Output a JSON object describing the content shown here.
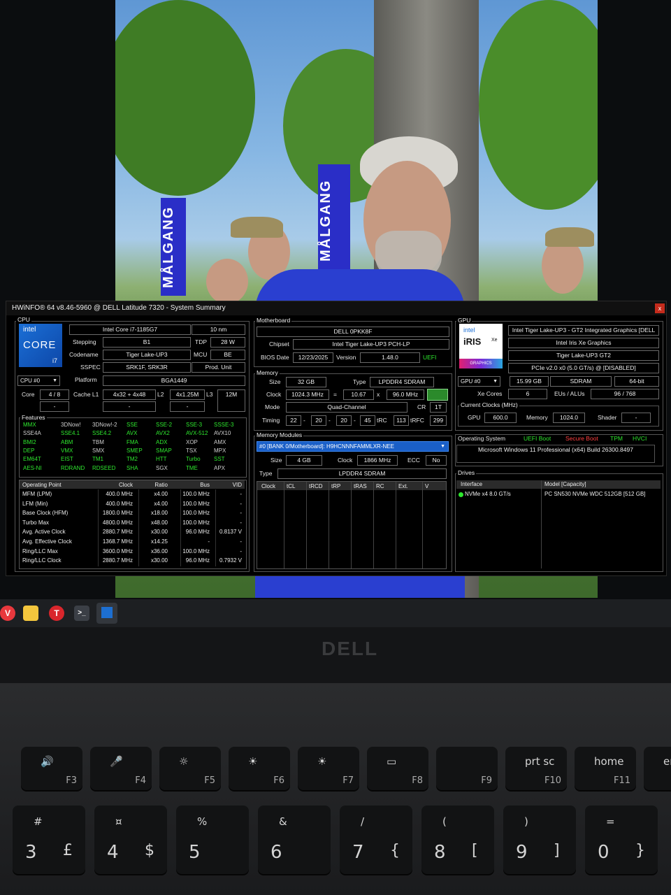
{
  "photo": {
    "banners": [
      "MÅLGANG",
      "MÅLGANG"
    ]
  },
  "window": {
    "title": "HWiNFO® 64 v8.46-5960 @ DELL Latitude 7320 - System Summary",
    "close": "x"
  },
  "cpu": {
    "group_label": "CPU",
    "logo_brand": "intel",
    "logo_core": "CORE",
    "logo_tier": "i7",
    "name": "Intel Core i7-1185G7",
    "process": "10 nm",
    "stepping_label": "Stepping",
    "stepping": "B1",
    "tdp_label": "TDP",
    "tdp": "28 W",
    "codename_label": "Codename",
    "codename": "Tiger Lake-UP3",
    "mcu_label": "MCU",
    "mcu": "BE",
    "sspec_label": "SSPEC",
    "sspec": "SRK1F, SRK3R",
    "prod_unit": "Prod. Unit",
    "selector": "CPU #0",
    "platform_label": "Platform",
    "platform": "BGA1449",
    "core_label": "Core",
    "core": "4 / 8",
    "cache_l1_label": "Cache L1",
    "cache_l1": "4x32 + 4x48",
    "l2_label": "L2",
    "l2": "4x1.25M",
    "l3_label": "L3",
    "l3": "12M",
    "blank1": "-",
    "blank2": "-",
    "blank3": "-",
    "features_label": "Features",
    "features": [
      [
        "MMX",
        "g"
      ],
      [
        "3DNow!",
        "w"
      ],
      [
        "3DNow!-2",
        "w"
      ],
      [
        "SSE",
        "g"
      ],
      [
        "SSE-2",
        "g"
      ],
      [
        "SSE-3",
        "g"
      ],
      [
        "SSSE-3",
        "g"
      ],
      [
        "SSE4A",
        "w"
      ],
      [
        "SSE4.1",
        "g"
      ],
      [
        "SSE4.2",
        "g"
      ],
      [
        "AVX",
        "g"
      ],
      [
        "AVX2",
        "g"
      ],
      [
        "AVX-512",
        "g"
      ],
      [
        "AVX10",
        "w"
      ],
      [
        "BMI2",
        "g"
      ],
      [
        "ABM",
        "g"
      ],
      [
        "TBM",
        "w"
      ],
      [
        "FMA",
        "g"
      ],
      [
        "ADX",
        "g"
      ],
      [
        "XOP",
        "w"
      ],
      [
        "AMX",
        "w"
      ],
      [
        "DEP",
        "g"
      ],
      [
        "VMX",
        "g"
      ],
      [
        "SMX",
        "w"
      ],
      [
        "SMEP",
        "g"
      ],
      [
        "SMAP",
        "g"
      ],
      [
        "TSX",
        "w"
      ],
      [
        "MPX",
        "w"
      ],
      [
        "EM64T",
        "g"
      ],
      [
        "EIST",
        "g"
      ],
      [
        "TM1",
        "g"
      ],
      [
        "TM2",
        "g"
      ],
      [
        "HTT",
        "g"
      ],
      [
        "Turbo",
        "g"
      ],
      [
        "SST",
        "g"
      ],
      [
        "AES-NI",
        "g"
      ],
      [
        "RDRAND",
        "g"
      ],
      [
        "RDSEED",
        "g"
      ],
      [
        "SHA",
        "g"
      ],
      [
        "SGX",
        "w"
      ],
      [
        "TME",
        "g"
      ],
      [
        "APX",
        "w"
      ]
    ],
    "op_headers": [
      "Operating Point",
      "Clock",
      "Ratio",
      "Bus",
      "VID"
    ],
    "op_rows": [
      [
        "MFM (LPM)",
        "400.0 MHz",
        "x4.00",
        "100.0 MHz",
        "-"
      ],
      [
        "LFM (Min)",
        "400.0 MHz",
        "x4.00",
        "100.0 MHz",
        "-"
      ],
      [
        "Base Clock (HFM)",
        "1800.0 MHz",
        "x18.00",
        "100.0 MHz",
        "-"
      ],
      [
        "Turbo Max",
        "4800.0 MHz",
        "x48.00",
        "100.0 MHz",
        "-"
      ],
      [
        "Avg. Active Clock",
        "2880.7 MHz",
        "x30.00",
        "96.0 MHz",
        "0.8137 V"
      ],
      [
        "Avg. Effective Clock",
        "1368.7 MHz",
        "x14.25",
        "-",
        "-"
      ],
      [
        "Ring/LLC Max",
        "3600.0 MHz",
        "x36.00",
        "100.0 MHz",
        "-"
      ],
      [
        "Ring/LLC Clock",
        "2880.7 MHz",
        "x30.00",
        "96.0 MHz",
        "0.7932 V"
      ]
    ]
  },
  "motherboard": {
    "group_label": "Motherboard",
    "name": "DELL 0PKK8F",
    "chipset_label": "Chipset",
    "chipset": "Intel Tiger Lake-UP3 PCH-LP",
    "bios_date_label": "BIOS Date",
    "bios_date": "12/23/2025",
    "version_label": "Version",
    "version": "1.48.0",
    "uefi": "UEFI"
  },
  "memory": {
    "group_label": "Memory",
    "size_label": "Size",
    "size": "32 GB",
    "type_label": "Type",
    "type": "LPDDR4 SDRAM",
    "clock_label": "Clock",
    "clock": "1024.3 MHz",
    "eq": "=",
    "ratio": "10.67",
    "x": "x",
    "bus": "96.0 MHz",
    "mode_label": "Mode",
    "mode": "Quad-Channel",
    "cr_label": "CR",
    "cr": "1T",
    "timing_label": "Timing",
    "t1": "22",
    "t2": "20",
    "t3": "20",
    "t4": "45",
    "dash": "-",
    "trc_label": "tRC",
    "trc": "113",
    "trfc_label": "tRFC",
    "trfc": "299"
  },
  "modules": {
    "group_label": "Memory Modules",
    "selected": "#0 [BANK 0/Motherboard]: H9HCNNNFAMMLXR-NEE",
    "size_label": "Size",
    "size": "4 GB",
    "clock_label": "Clock",
    "clock": "1866 MHz",
    "ecc_label": "ECC",
    "ecc": "No",
    "type_label": "Type",
    "type": "LPDDR4 SDRAM",
    "timing_headers": [
      "Clock",
      "tCL",
      "tRCD",
      "tRP",
      "tRAS",
      "RC",
      "Ext.",
      "V"
    ]
  },
  "gpu": {
    "group_label": "GPU",
    "logo_brand": "intel",
    "logo_name": "iRIS",
    "logo_sub": "Xe",
    "logo_graphics": "GRAPHICS",
    "name": "Intel Tiger Lake-UP3 - GT2 Integrated Graphics [DELL",
    "subname": "Intel Iris Xe Graphics",
    "codename": "Tiger Lake-UP3 GT2",
    "pcie": "PCIe v2.0 x0 (5.0 GT/s) @ [DISABLED]",
    "selector": "GPU #0",
    "vram": "15.99 GB",
    "vram_type": "SDRAM",
    "bus_width": "64-bit",
    "xe_cores_label": "Xe Cores",
    "xe_cores": "6",
    "eus_label": "EUs / ALUs",
    "eus": "96 / 768",
    "clocks_label": "Current Clocks (MHz)",
    "gpu_clock_label": "GPU",
    "gpu_clock": "600.0",
    "mem_clock_label": "Memory",
    "mem_clock": "1024.0",
    "shader_label": "Shader",
    "shader": "-"
  },
  "os": {
    "label": "Operating System",
    "uefi_boot": "UEFI Boot",
    "secure_boot": "Secure Boot",
    "tpm": "TPM",
    "hvci": "HVCI",
    "name": "Microsoft Windows 11 Professional (x64) Build 26300.8497"
  },
  "drives": {
    "label": "Drives",
    "headers": [
      "Interface",
      "Model [Capacity]"
    ],
    "rows": [
      [
        "NVMe x4 8.0 GT/s",
        "PC SN530 NVMe WDC 512GB [512 GB]"
      ]
    ]
  },
  "taskbar": {
    "apps": [
      "vivaldi",
      "file-explorer",
      "tusk",
      "terminal",
      "hwinfo"
    ],
    "t_letter": "T"
  },
  "laptop": {
    "logo": "DELL",
    "fkeys": [
      {
        "top": "🔊",
        "sub": "F3"
      },
      {
        "top": "🎤",
        "sub": "F4"
      },
      {
        "top": "☼",
        "sub": "F5"
      },
      {
        "top": "☀",
        "sub": "F6"
      },
      {
        "top": "☀",
        "sub": "F7"
      },
      {
        "top": "▭",
        "sub": "F8"
      },
      {
        "top": "",
        "sub": "F9"
      },
      {
        "top": "prt sc",
        "sub": "F10"
      },
      {
        "top": "home",
        "sub": "F11"
      },
      {
        "top": "en",
        "sub": ""
      }
    ],
    "numkeys": [
      {
        "top": "#",
        "main": "3",
        "alt": "£"
      },
      {
        "top": "¤",
        "main": "4",
        "alt": "$"
      },
      {
        "top": "%",
        "main": "5",
        "alt": ""
      },
      {
        "top": "&",
        "main": "6",
        "alt": ""
      },
      {
        "top": "/",
        "main": "7",
        "alt": "{"
      },
      {
        "top": "(",
        "main": "8",
        "alt": "["
      },
      {
        "top": ")",
        "main": "9",
        "alt": "]"
      },
      {
        "top": "=",
        "main": "0",
        "alt": "}"
      }
    ]
  }
}
